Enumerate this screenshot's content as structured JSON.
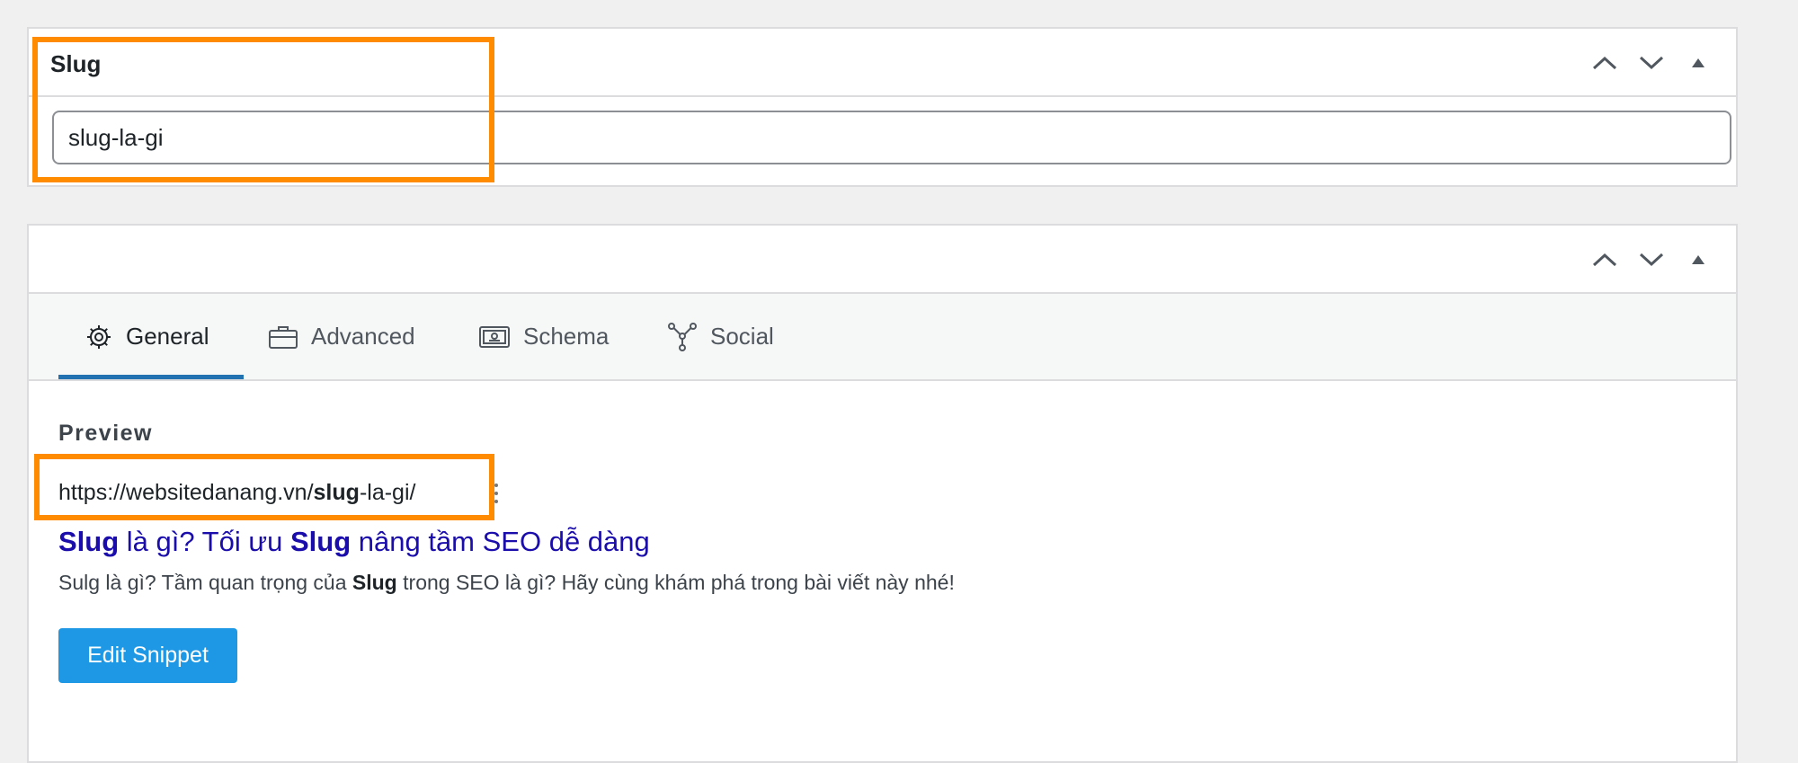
{
  "slug_panel": {
    "title": "Slug",
    "input_value": "slug-la-gi"
  },
  "seo_panel": {
    "tabs": [
      {
        "label": "General",
        "icon": "gear-icon",
        "active": true
      },
      {
        "label": "Advanced",
        "icon": "briefcase-icon",
        "active": false
      },
      {
        "label": "Schema",
        "icon": "schema-icon",
        "active": false
      },
      {
        "label": "Social",
        "icon": "social-share-icon",
        "active": false
      }
    ],
    "preview": {
      "label": "Preview",
      "url_prefix": "https://websitedanang.vn/",
      "url_slug_bold": "slug",
      "url_suffix": "-la-gi/",
      "title_part1": "Slug",
      "title_part2": " là gì? Tối ưu ",
      "title_part3": "Slug",
      "title_part4": " nâng tầm SEO dễ dàng",
      "desc_part1": "Sulg là gì? Tầm quan trọng của ",
      "desc_part2": "Slug",
      "desc_part3": " trong SEO là gì? Hãy cùng khám phá trong bài viết này nhé!"
    },
    "edit_button": "Edit Snippet"
  },
  "colors": {
    "highlight": "#ff8c00",
    "accent_tab": "#2271b1",
    "button": "#1e98e4",
    "serp_link": "#1a0dab"
  }
}
